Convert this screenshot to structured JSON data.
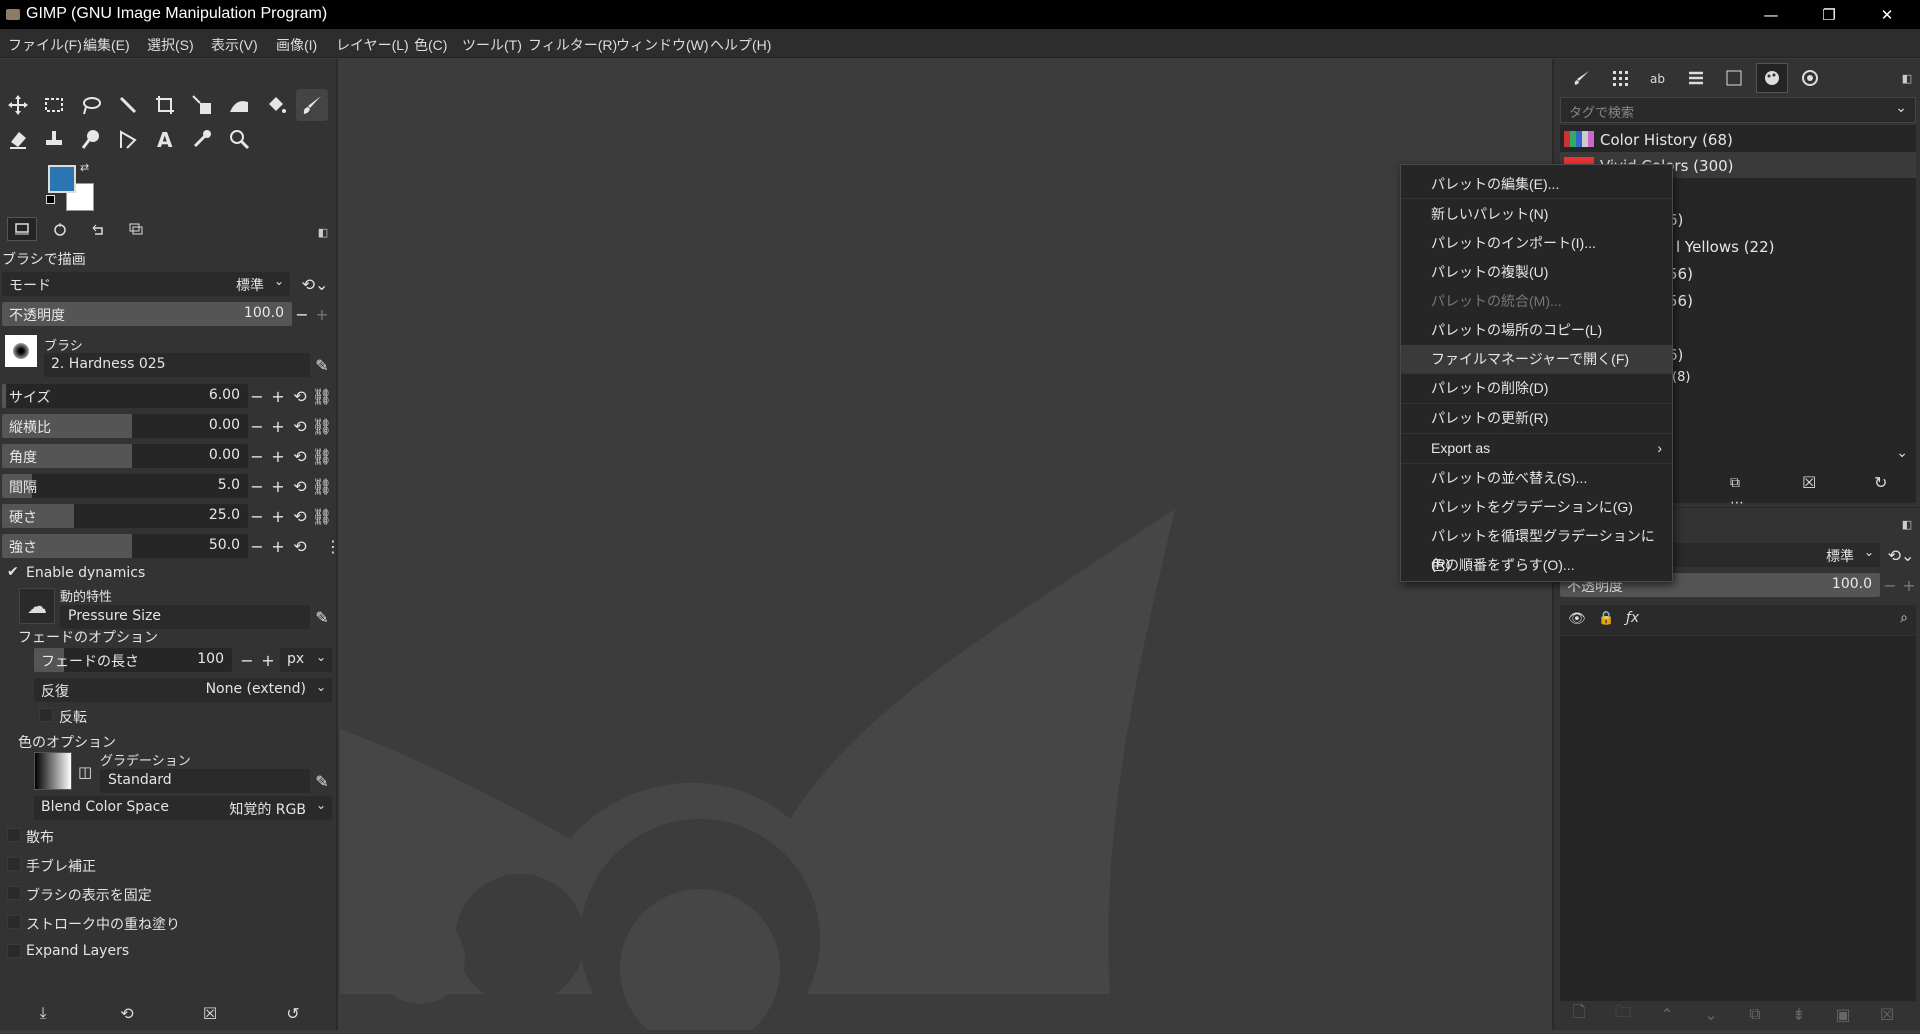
{
  "window": {
    "title": "GIMP (GNU Image Manipulation Program)",
    "minimize": "—",
    "maximize": "❐",
    "close": "✕"
  },
  "menubar": [
    "ファイル(F)",
    "編集(E)",
    "選択(S)",
    "表示(V)",
    "画像(I)",
    "レイヤー(L)",
    "色(C)",
    "ツール(T)",
    "フィルター(R)",
    "ウィンドウ(W)",
    "ヘルプ(H)"
  ],
  "colors": {
    "foreground": "#2b75b3",
    "background": "#ffffff"
  },
  "tool_options": {
    "title": "ブラシで描画",
    "mode_label": "モード",
    "mode_value": "標準",
    "opacity_label": "不透明度",
    "opacity_value": "100.0",
    "brush_label": "ブラシ",
    "brush_value": "2. Hardness 025",
    "size_label": "サイズ",
    "size_value": "6.00",
    "aspect_label": "縦横比",
    "aspect_value": "0.00",
    "angle_label": "角度",
    "angle_value": "0.00",
    "spacing_label": "間隔",
    "spacing_value": "5.0",
    "hardness_label": "硬さ",
    "hardness_value": "25.0",
    "force_label": "強さ",
    "force_value": "50.0",
    "enable_dynamics": "Enable dynamics",
    "dynamics_label": "動的特性",
    "dynamics_value": "Pressure Size",
    "fade_options": "フェードのオプション",
    "fade_length_label": "フェードの長さ",
    "fade_length_value": "100",
    "fade_unit": "px",
    "repeat_label": "反復",
    "repeat_value": "None (extend)",
    "reverse_label": "反転",
    "color_options": "色のオプション",
    "gradient_label": "グラデーション",
    "gradient_value": "Standard",
    "blend_space_label": "Blend Color Space",
    "blend_space_value": "知覚的 RGB",
    "scatter": "散布",
    "smooth": "手ブレ補正",
    "lock_brush": "ブラシの表示を固定",
    "incremental": "ストローク中の重ね塗り",
    "expand_layers": "Expand Layers"
  },
  "right_panel": {
    "tag_search_placeholder": "タグで検索",
    "palettes": [
      {
        "name": "Color History (68)"
      },
      {
        "name": "Vivid Colors (300)"
      },
      {
        "name": "6)"
      },
      {
        "name": "l Yellows (22)"
      },
      {
        "name": "56)"
      },
      {
        "name": "56)"
      },
      {
        "name": "6)"
      },
      {
        "name": "(8)"
      }
    ],
    "layers_mode_value": "標準",
    "layers_opacity_label": "不透明度",
    "layers_opacity_value": "100.0"
  },
  "context_menu": {
    "items": [
      {
        "label": "パレットの編集(E)...",
        "disabled": false
      },
      {
        "label": "新しいパレット(N)",
        "disabled": false
      },
      {
        "label": "パレットのインポート(I)...",
        "disabled": false
      },
      {
        "label": "パレットの複製(U)",
        "disabled": false
      },
      {
        "label": "パレットの統合(M)...",
        "disabled": true
      },
      {
        "label": "パレットの場所のコピー(L)",
        "disabled": false
      },
      {
        "label": "ファイルマネージャーで開く(F)",
        "disabled": false
      },
      {
        "label": "パレットの削除(D)",
        "disabled": false
      },
      {
        "label": "パレットの更新(R)",
        "disabled": false
      },
      {
        "label": "Export as",
        "disabled": false
      },
      {
        "label": "パレットの並べ替え(S)...",
        "disabled": false
      },
      {
        "label": "パレットをグラデーションに(G)",
        "disabled": false
      },
      {
        "label": "パレットを循環型グラデーションに(R)",
        "disabled": false
      },
      {
        "label": "色の順番をずらす(O)...",
        "disabled": false
      }
    ]
  }
}
